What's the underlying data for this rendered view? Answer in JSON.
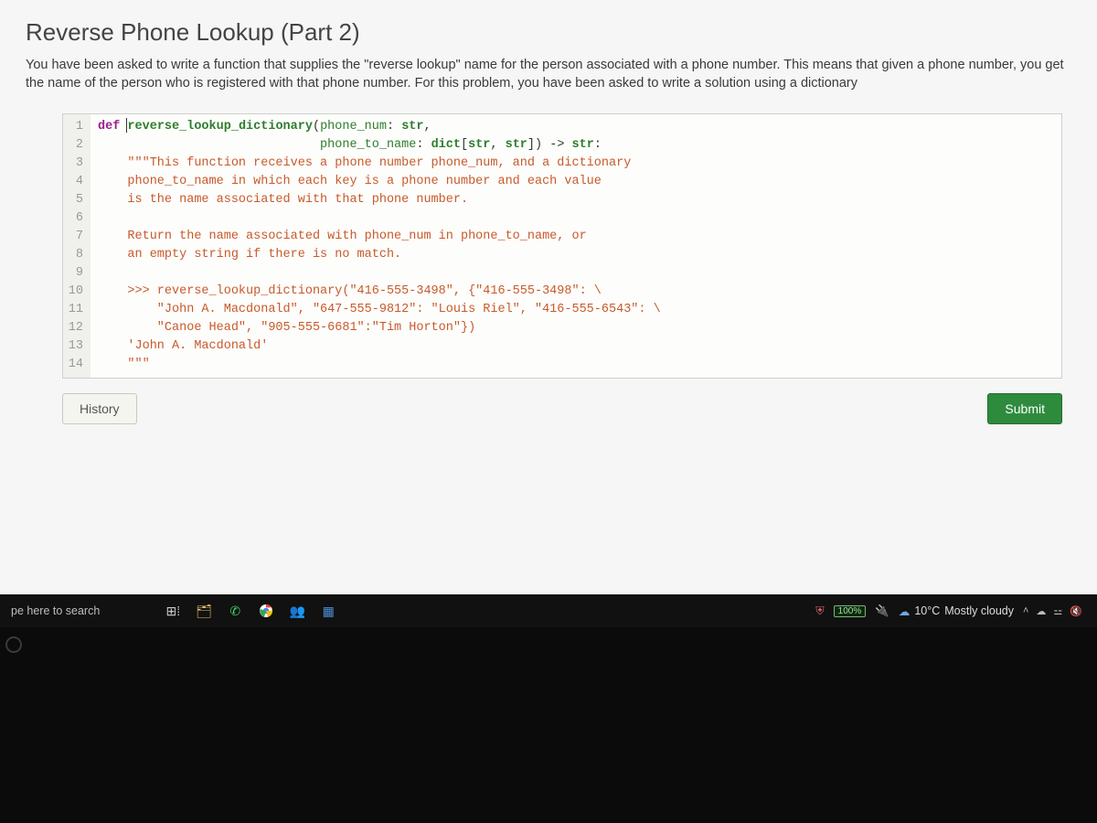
{
  "problem": {
    "title": "Reverse Phone Lookup (Part 2)",
    "description": "You have been asked to write a function that supplies the \"reverse lookup\" name for the person associated with a phone number. This means that given a phone number, you get the name of the person who is registered with that phone number. For this problem, you have been asked to write a solution using a dictionary"
  },
  "code": {
    "lines": [
      "def reverse_lookup_dictionary(phone_num: str,",
      "                              phone_to_name: dict[str, str]) -> str:",
      "    \"\"\"This function receives a phone number phone_num, and a dictionary",
      "    phone_to_name in which each key is a phone number and each value",
      "    is the name associated with that phone number.",
      "",
      "    Return the name associated with phone_num in phone_to_name, or",
      "    an empty string if there is no match.",
      "",
      "    >>> reverse_lookup_dictionary(\"416-555-3498\", {\"416-555-3498\": \\",
      "        \"John A. Macdonald\", \"647-555-9812\": \"Louis Riel\", \"416-555-6543\": \\",
      "        \"Canoe Head\", \"905-555-6681\":\"Tim Horton\"})",
      "    'John A. Macdonald'",
      "    \"\"\""
    ],
    "line_count": 14
  },
  "buttons": {
    "history": "History",
    "submit": "Submit"
  },
  "taskbar": {
    "search_placeholder": "pe here to search",
    "battery": "100%",
    "weather_temp": "10°C",
    "weather_cond": "Mostly cloudy"
  }
}
